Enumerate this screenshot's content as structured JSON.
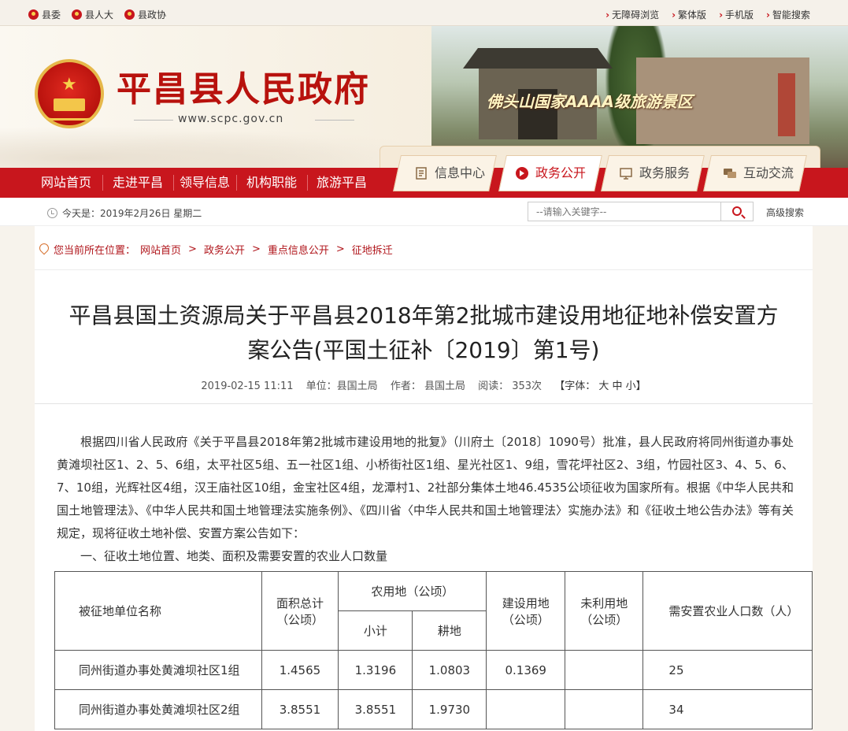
{
  "topbar": {
    "left_links": [
      "县委",
      "县人大",
      "县政协"
    ],
    "right_links": [
      "无障碍浏览",
      "繁体版",
      "手机版",
      "智能搜索"
    ]
  },
  "header": {
    "site_title": "平昌县人民政府",
    "site_url": "www.scpc.gov.cn",
    "banner_caption": "佛头山国家AAAA级旅游景区"
  },
  "nav": {
    "items": [
      "网站首页",
      "走进平昌",
      "领导信息",
      "机构职能",
      "旅游平昌"
    ],
    "tabs": [
      {
        "label": "信息中心",
        "icon": "document-icon",
        "active": false
      },
      {
        "label": "政务公开",
        "icon": "arrow-circle-icon",
        "active": true
      },
      {
        "label": "政务服务",
        "icon": "monitor-icon",
        "active": false
      },
      {
        "label": "互动交流",
        "icon": "chat-icon",
        "active": false
      }
    ]
  },
  "infobar": {
    "date": "今天是：2019年2月26日 星期二",
    "search_placeholder": "--请输入关键字--",
    "advanced_search": "高级搜索"
  },
  "breadcrumb": {
    "prefix": "您当前所在位置：",
    "items": [
      "网站首页",
      "政务公开",
      "重点信息公开",
      "征地拆迁"
    ]
  },
  "article": {
    "title_line1": "平昌县国土资源局关于平昌县2018年第2批城市建设用地征地补偿安置方",
    "title_line2": "案公告(平国土征补〔2019〕第1号)",
    "meta": {
      "datetime": "2019-02-15 11:11",
      "unit": "单位：县国土局",
      "author": "作者： 县国土局",
      "reads": "阅读： 353次",
      "font_size": "【字体： 大 中 小】"
    },
    "paragraph": "根据四川省人民政府《关于平昌县2018年第2批城市建设用地的批复》（川府土〔2018〕1090号）批准，县人民政府将同州街道办事处黄滩坝社区1、2、5、6组，太平社区5组、五一社区1组、小桥街社区1组、星光社区1、9组，雪花坪社区2、3组，竹园社区3、4、5、6、7、10组，光辉社区4组，汉王庙社区10组，金宝社区4组，龙潭村1、2社部分集体土地46.4535公顷征收为国家所有。根据《中华人民共和国土地管理法》、《中华人民共和国土地管理法实施条例》、《四川省〈中华人民共和国土地管理法〉实施办法》和《征收土地公告办法》等有关规定，现将征收土地补偿、安置方案公告如下：",
    "section1": "一、征收土地位置、地类、面积及需要安置的农业人口数量"
  },
  "table": {
    "headers": {
      "unit_name": "被征地单位名称",
      "total_area": "面积总计",
      "total_area_unit": "（公顷）",
      "agri": "农用地（公顷）",
      "subtotal": "小计",
      "farmland": "耕地",
      "construction": "建设用地",
      "construction_unit": "（公顷）",
      "unused": "未利用地",
      "unused_unit": "（公顷）",
      "population": "需安置农业人口数（人）"
    },
    "rows": [
      {
        "name": "同州街道办事处黄滩坝社区1组",
        "total": "1.4565",
        "subtotal": "1.3196",
        "farmland": "1.0803",
        "construction": "0.1369",
        "unused": "",
        "population": "25"
      },
      {
        "name": "同州街道办事处黄滩坝社区2组",
        "total": "3.8551",
        "subtotal": "3.8551",
        "farmland": "1.9730",
        "construction": "",
        "unused": "",
        "population": "34"
      }
    ]
  }
}
